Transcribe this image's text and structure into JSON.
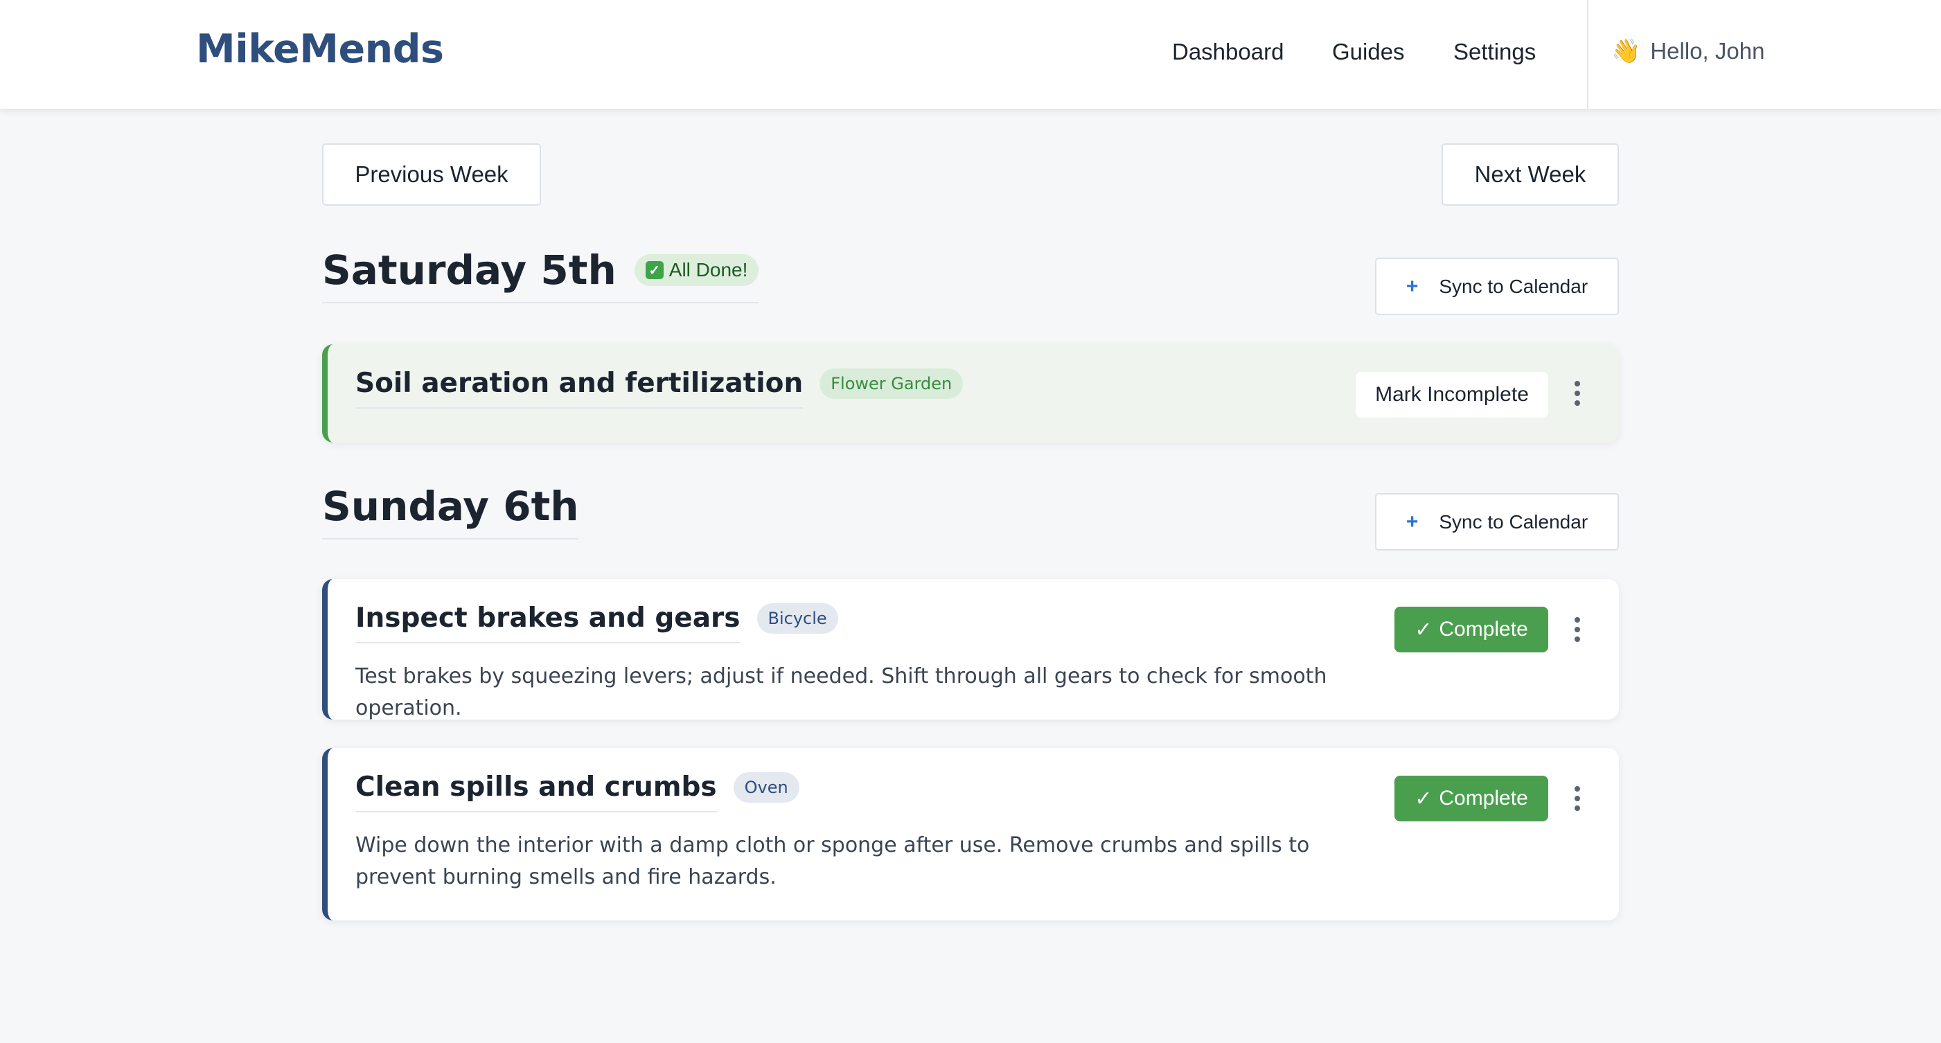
{
  "header": {
    "logo": "MikeMends",
    "nav": [
      "Dashboard",
      "Guides",
      "Settings"
    ],
    "greeting_emoji": "👋",
    "greeting": "Hello, John"
  },
  "week_nav": {
    "previous": "Previous Week",
    "next": "Next Week"
  },
  "days": [
    {
      "title": "Saturday 5th",
      "badge_icon": "✓",
      "badge": "All Done!",
      "sync_icon": "+",
      "sync_label": "Sync to Calendar",
      "tasks": [
        {
          "title": "Soil aeration and fertilization",
          "tag": "Flower Garden",
          "action": "Mark Incomplete",
          "completed": true
        }
      ]
    },
    {
      "title": "Sunday 6th",
      "sync_icon": "+",
      "sync_label": "Sync to Calendar",
      "tasks": [
        {
          "title": "Inspect brakes and gears",
          "tag": "Bicycle",
          "description": "Test brakes by squeezing levers; adjust if needed. Shift through all gears to check for smooth operation.",
          "action_icon": "✓",
          "action": "Complete",
          "completed": false
        },
        {
          "title": "Clean spills and crumbs",
          "tag": "Oven",
          "description": "Wipe down the interior with a damp cloth or sponge after use. Remove crumbs and spills to prevent burning smells and fire hazards.",
          "action_icon": "✓",
          "action": "Complete",
          "completed": false
        }
      ]
    }
  ],
  "colors": {
    "brand": "#2e4e7e",
    "success": "#4a9f4f",
    "sync_plus": "#2f74d0",
    "background": "#f6f7f9"
  }
}
